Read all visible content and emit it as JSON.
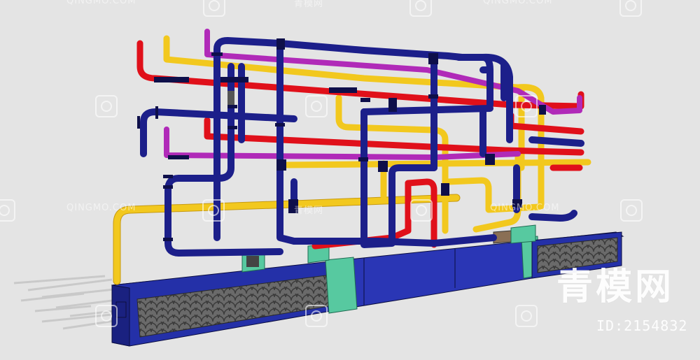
{
  "watermark": {
    "brand": "青模网",
    "id_text": "ID:2154832",
    "text": "QINGMO.COM",
    "cn_text": "青模网"
  },
  "colors": {
    "background": "#e4e4e4",
    "pipe_blue": "#1c1f8a",
    "pipe_red": "#e0101a",
    "pipe_yellow": "#f2c81e",
    "pipe_magenta": "#b02ab8",
    "base_blue": "#2430a8",
    "base_green": "#57c9a0",
    "panel_gray": "#555555"
  }
}
